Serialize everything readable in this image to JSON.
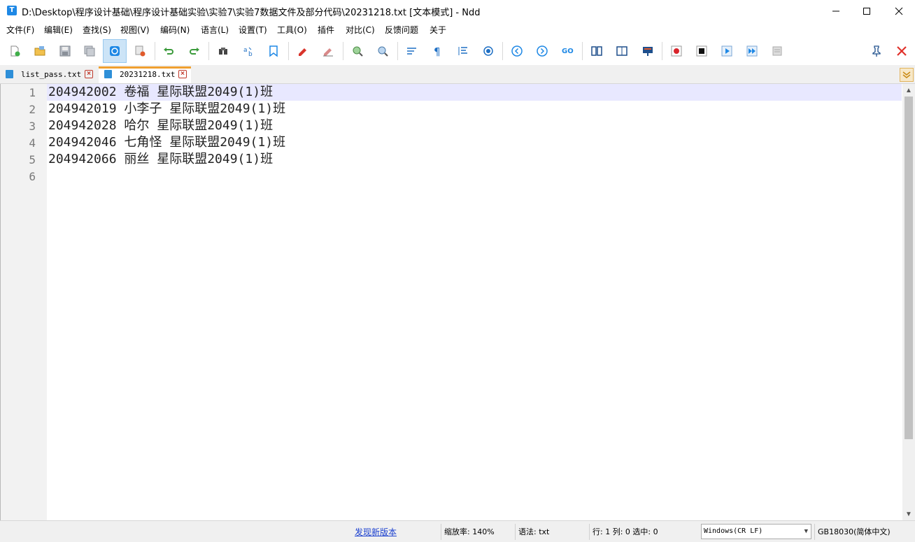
{
  "window": {
    "title": "D:\\Desktop\\程序设计基础\\程序设计基础实验\\实验7\\实验7数据文件及部分代码\\20231218.txt [文本模式] - Ndd",
    "app_icon_letter": "T",
    "minimize_icon": "minimize-icon",
    "maximize_icon": "maximize-icon",
    "close_icon": "close-icon"
  },
  "menu": [
    "文件(F)",
    "编辑(E)",
    "查找(S)",
    "视图(V)",
    "编码(N)",
    "语言(L)",
    "设置(T)",
    "工具(O)",
    "插件",
    "对比(C)",
    "反馈问题",
    "关于"
  ],
  "toolbar": {
    "buttons": [
      "new-file-icon",
      "open-file-icon",
      "save-icon",
      "save-all-icon",
      "auto-save-icon",
      "close-file-icon",
      "undo-icon",
      "redo-icon",
      "find-icon",
      "replace-icon",
      "bookmark-icon",
      "mark-icon",
      "clear-mark-icon",
      "zoom-in-icon",
      "zoom-out-icon",
      "word-wrap-icon",
      "show-symbols-icon",
      "indent-guide-icon",
      "white-space-icon",
      "prev-icon",
      "next-icon",
      "goto-icon",
      "compare-icon",
      "split-icon",
      "preview-icon",
      "record-macro-icon",
      "stop-macro-icon",
      "play-macro-icon",
      "run-macro-multiple-icon",
      "save-macro-icon"
    ],
    "pin_icon": "pin-icon",
    "exit_icon": "exit-icon",
    "accent_color": "#1e88e5"
  },
  "tabs": [
    {
      "label": "list_pass.txt",
      "active": false
    },
    {
      "label": "20231218.txt",
      "active": true
    }
  ],
  "editor": {
    "current_line": 1,
    "lines": [
      "204942002 卷福 星际联盟2049(1)班",
      "204942019 小李子 星际联盟2049(1)班",
      "204942028 哈尔 星际联盟2049(1)班",
      "204942046 七角怪 星际联盟2049(1)班",
      "204942066 丽丝 星际联盟2049(1)班",
      ""
    ],
    "line_numbers": [
      "1",
      "2",
      "3",
      "4",
      "5",
      "6"
    ]
  },
  "status": {
    "update_link": "发现新版本",
    "zoom": "缩放率: 140%",
    "syntax": "语法: txt",
    "position": "行: 1 列: 0 选中: 0",
    "line_ending": "Windows(CR LF)",
    "encoding": "GB18030(简体中文)"
  }
}
